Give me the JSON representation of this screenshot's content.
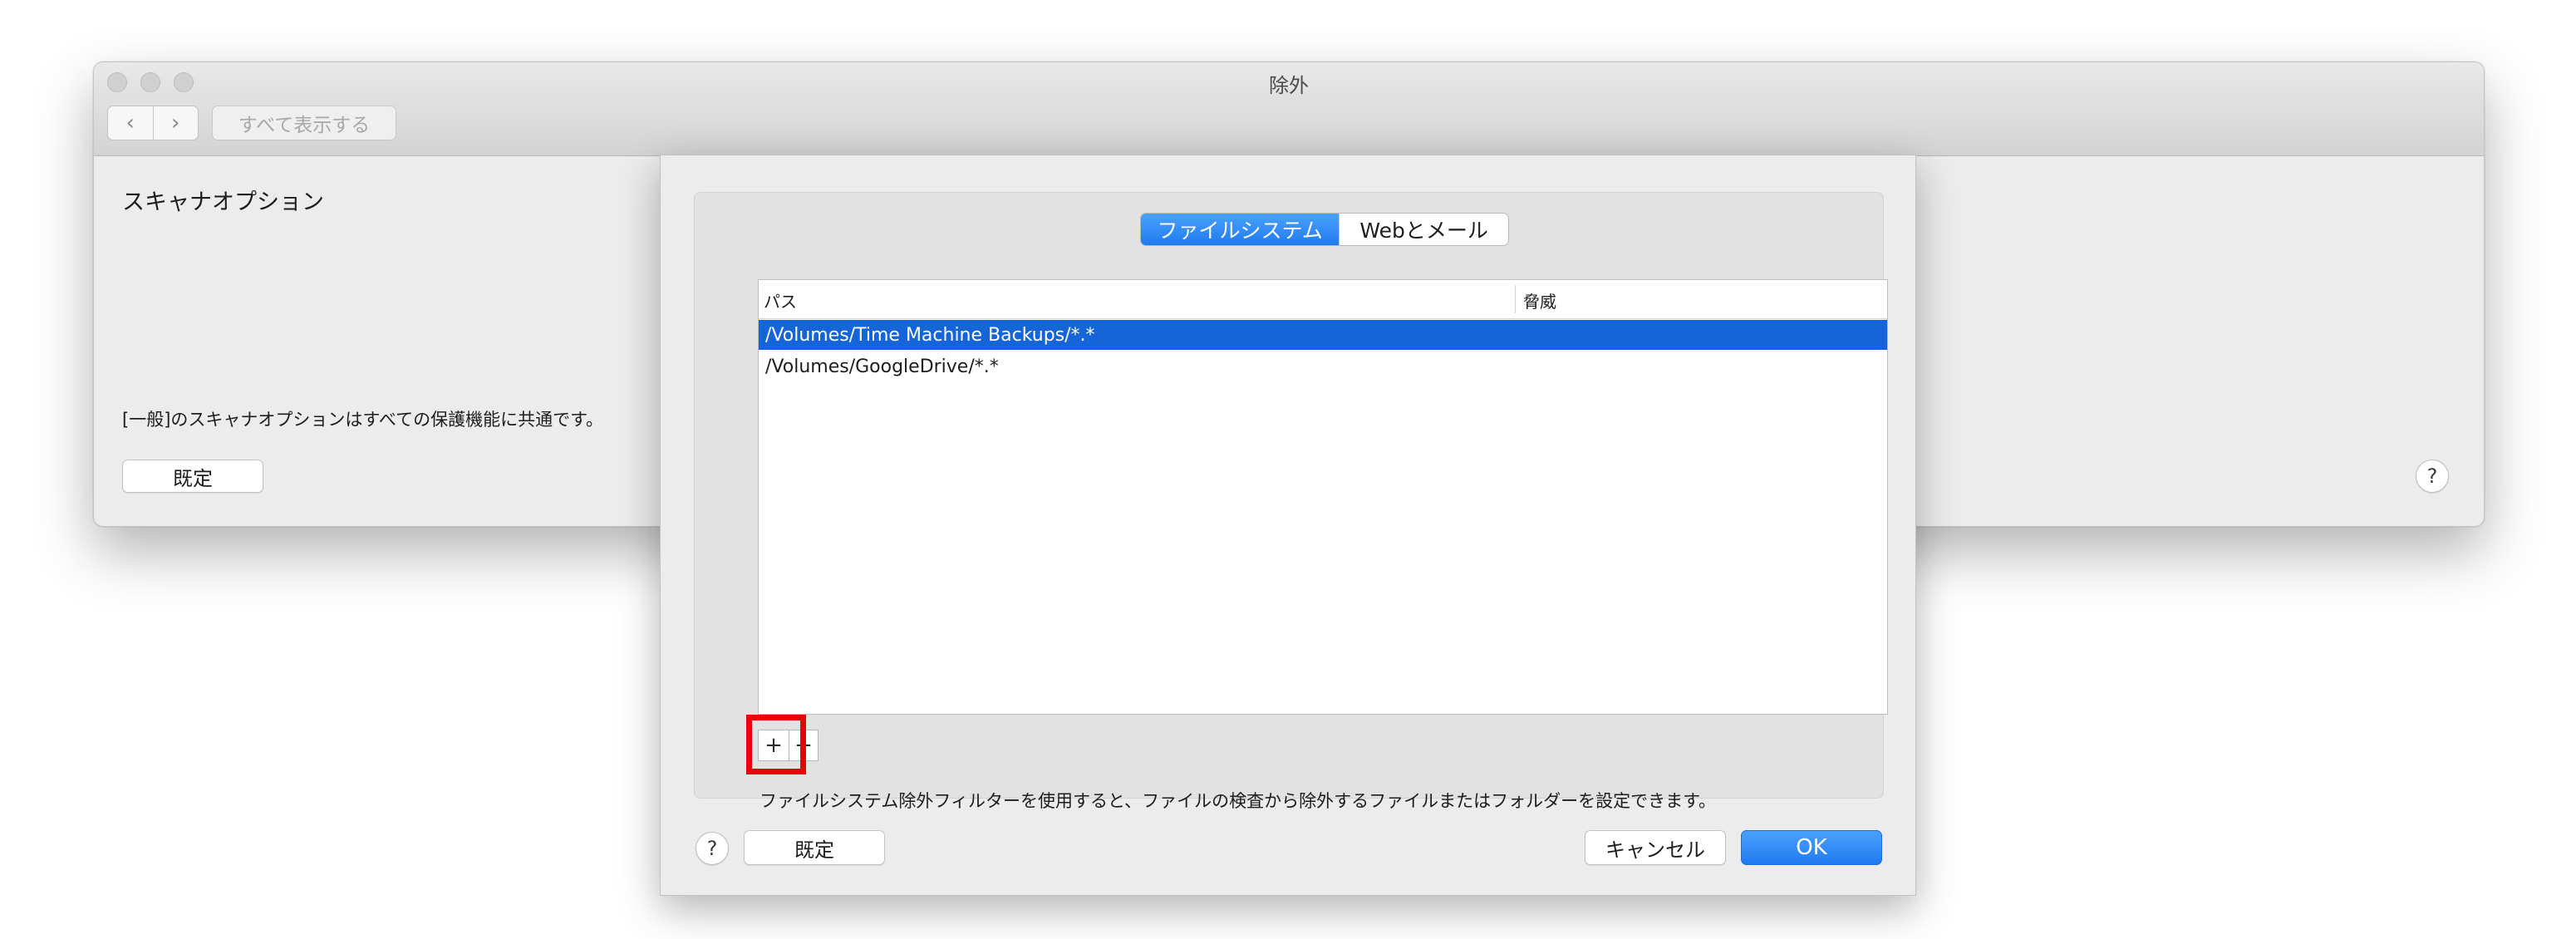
{
  "window": {
    "title": "除外",
    "nav_back": "‹",
    "nav_forward": "›",
    "show_all": "すべて表示する",
    "section_title": "スキャナオプション",
    "common_note": "[一般]のスキャナオプションはすべての保護機能に共通です。",
    "default_label": "既定",
    "help_label": "?"
  },
  "sheet": {
    "tabs": [
      {
        "label": "ファイルシステム",
        "selected": true
      },
      {
        "label": "Webとメール",
        "selected": false
      }
    ],
    "table": {
      "columns": [
        "パス",
        "脅威"
      ],
      "rows": [
        {
          "path": "/Volumes/Time Machine Backups/*.*",
          "threat": "",
          "selected": true
        },
        {
          "path": "/Volumes/GoogleDrive/*.*",
          "threat": "",
          "selected": false
        }
      ]
    },
    "add_label": "+",
    "remove_label": "−",
    "description": "ファイルシステム除外フィルターを使用すると、ファイルの検査から除外するファイルまたはフォルダーを設定できます。",
    "help_label": "?",
    "default_label": "既定",
    "cancel_label": "キャンセル",
    "ok_label": "OK"
  },
  "colors": {
    "accent": "#1f7cf2",
    "selection": "#1565d8",
    "highlight_box": "#e8000b"
  }
}
